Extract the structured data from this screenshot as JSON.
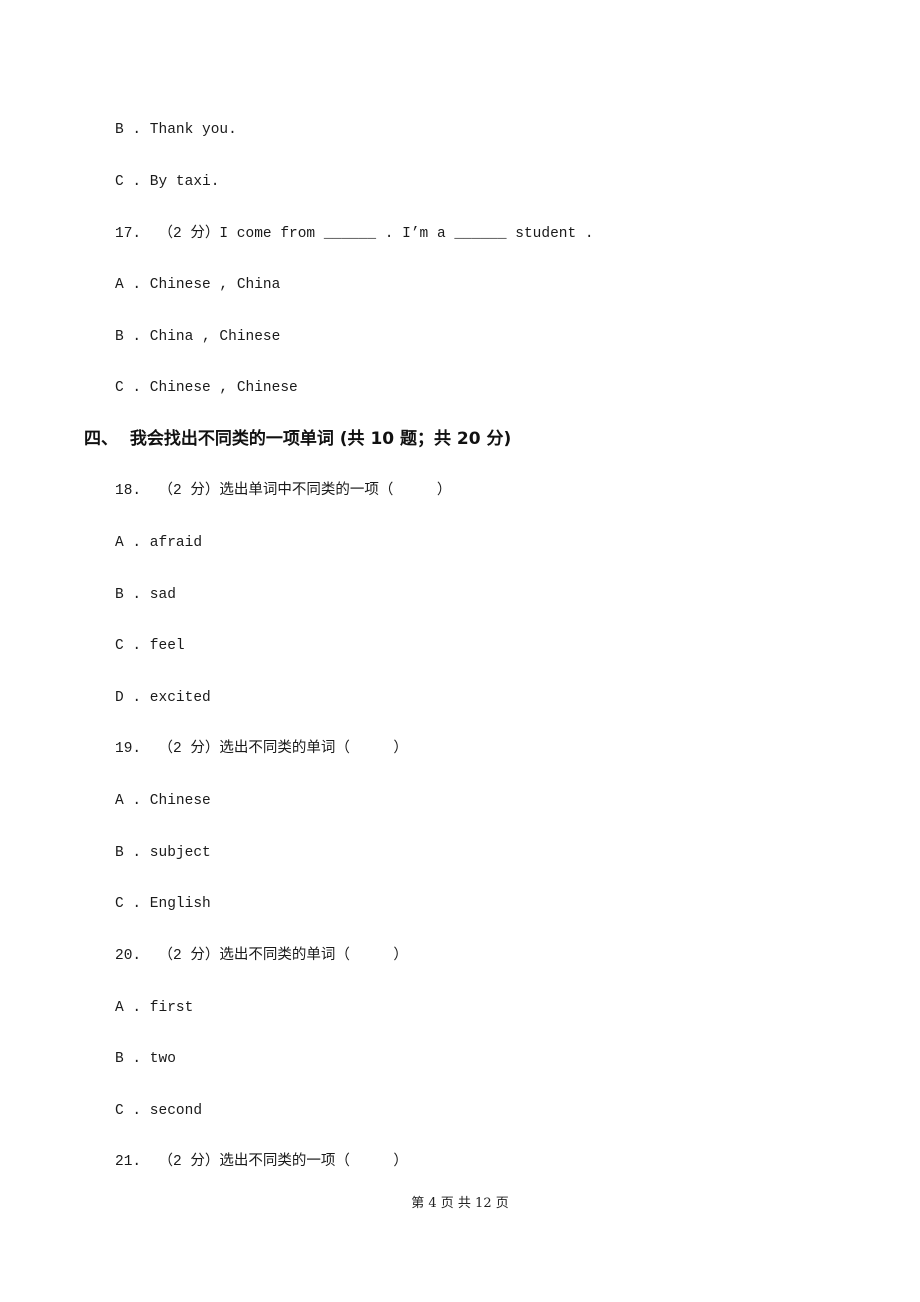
{
  "page": {
    "items": [
      {
        "id": "q16-B",
        "text": "B . Thank you."
      },
      {
        "id": "q16-C",
        "text": "C . By taxi."
      },
      {
        "id": "q17",
        "text": "17.  （2 分）I come from ______ . I’m a ______ student ."
      },
      {
        "id": "q17-A",
        "text": "A . Chinese , China"
      },
      {
        "id": "q17-B",
        "text": "B . China , Chinese"
      },
      {
        "id": "q17-C",
        "text": "C . Chinese , Chinese"
      },
      {
        "id": "q18",
        "text": "18.  （2 分）选出单词中不同类的一项（     ）"
      },
      {
        "id": "q18-A",
        "text": "A . afraid"
      },
      {
        "id": "q18-B",
        "text": "B . sad"
      },
      {
        "id": "q18-C",
        "text": "C . feel"
      },
      {
        "id": "q18-D",
        "text": "D . excited"
      },
      {
        "id": "q19",
        "text": "19.  （2 分）选出不同类的单词（     ）"
      },
      {
        "id": "q19-A",
        "text": "A . Chinese"
      },
      {
        "id": "q19-B",
        "text": "B . subject"
      },
      {
        "id": "q19-C",
        "text": "C . English"
      },
      {
        "id": "q20",
        "text": "20.  （2 分）选出不同类的单词（     ）"
      },
      {
        "id": "q20-A",
        "text": "A . first"
      },
      {
        "id": "q20-B",
        "text": "B . two"
      },
      {
        "id": "q20-C",
        "text": "C . second"
      },
      {
        "id": "q21",
        "text": "21.  （2 分）选出不同类的一项（     ）"
      }
    ],
    "section_heading": "四、  我会找出不同类的一项单词 (共 10 题；共 20 分)",
    "footer": "第 4 页 共 12 页"
  }
}
